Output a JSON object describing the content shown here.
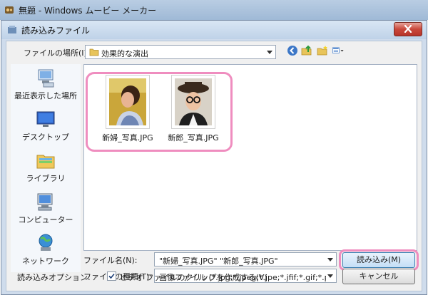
{
  "app": {
    "title": "無題 - Windows ムービー メーカー"
  },
  "dialog": {
    "title": "読み込みファイル",
    "location_label": "ファイルの場所(I):",
    "location_value": "効果的な演出",
    "places": [
      {
        "label": "最近表示した場所",
        "icon": "recent-places-icon"
      },
      {
        "label": "デスクトップ",
        "icon": "desktop-icon"
      },
      {
        "label": "ライブラリ",
        "icon": "library-icon"
      },
      {
        "label": "コンピューター",
        "icon": "computer-icon"
      },
      {
        "label": "ネットワーク",
        "icon": "network-icon"
      }
    ],
    "files": [
      {
        "name": "新婦_写真.JPG",
        "icon": "bride-photo-thumbnail"
      },
      {
        "name": "新郎_写真.JPG",
        "icon": "groom-photo-thumbnail"
      }
    ],
    "filename_label": "ファイル名(N):",
    "filename_value": "\"新婦_写真.JPG\" \"新郎_写真.JPG\"",
    "filetype_label": "ファイルの種類(T):",
    "filetype_value": "画像ファイル (*.jpg;*.jpeg;*.jpe;*.jfif;*.gif;*.png;*.bmp;*.c",
    "open_button": "読み込み(M)",
    "cancel_button": "キャンセル",
    "options_label": "読み込みオプション:",
    "clip_checkbox_label": "ビデオ ファイルのクリップを作成する(V)",
    "clip_checkbox_checked": true,
    "highlight_color": "#ef8dbf"
  }
}
